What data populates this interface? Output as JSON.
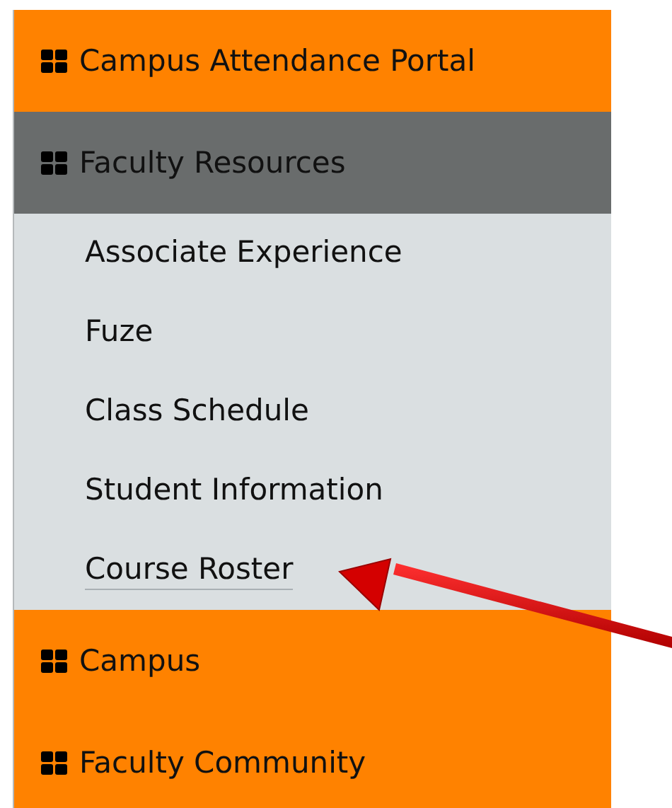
{
  "menu": [
    {
      "label": "Campus Attendance Portal",
      "expanded": false
    },
    {
      "label": "Faculty Resources",
      "expanded": true,
      "children": [
        {
          "label": "Associate Experience",
          "selected": false
        },
        {
          "label": "Fuze",
          "selected": false
        },
        {
          "label": "Class Schedule",
          "selected": false
        },
        {
          "label": "Student Information",
          "selected": false
        },
        {
          "label": "Course Roster",
          "selected": true
        }
      ]
    },
    {
      "label": "Campus",
      "expanded": false
    },
    {
      "label": "Faculty Community",
      "expanded": false
    }
  ]
}
